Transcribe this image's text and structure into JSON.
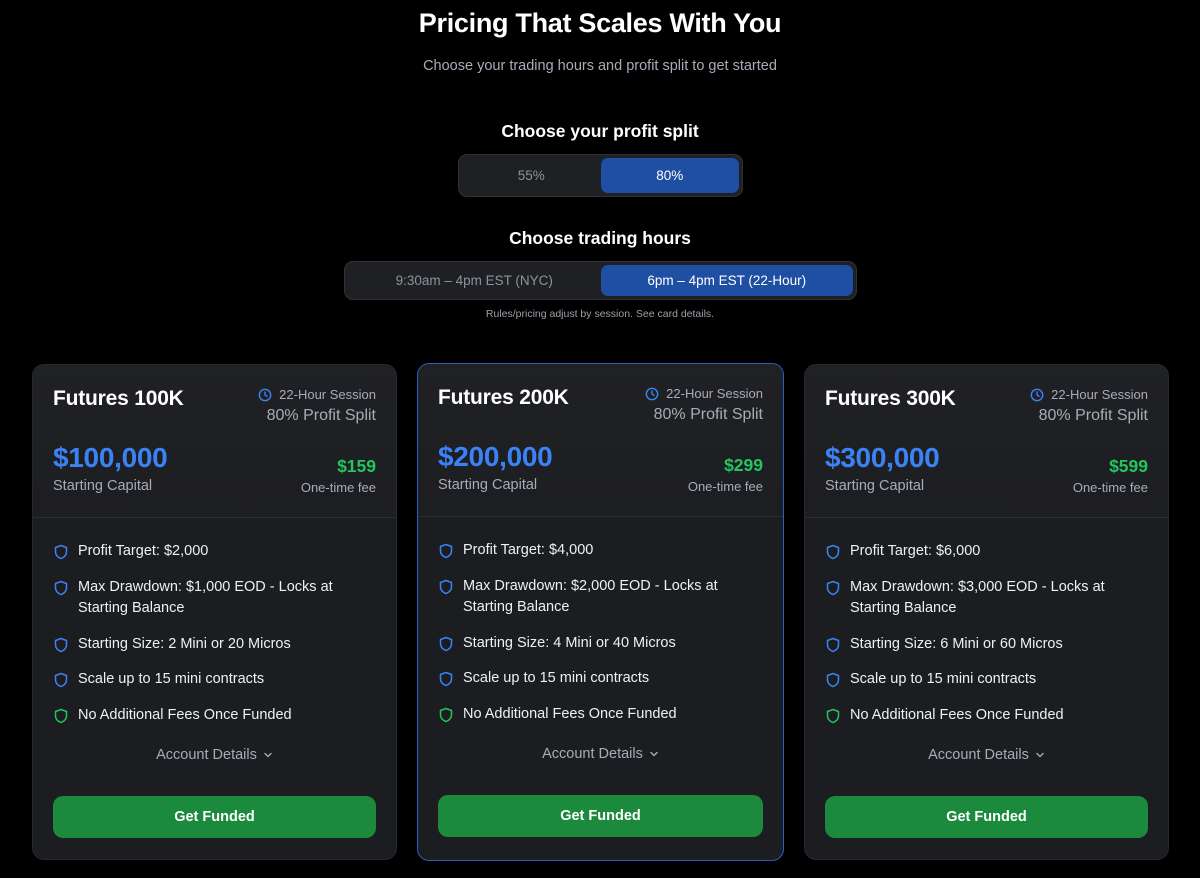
{
  "hero": {
    "title": "Pricing That Scales With You",
    "subtitle": "Choose your trading hours and profit split to get started"
  },
  "profit_split": {
    "label": "Choose your profit split",
    "options": [
      "55%",
      "80%"
    ],
    "selected": "80%"
  },
  "trading_hours": {
    "label": "Choose trading hours",
    "options": [
      "9:30am – 4pm EST (NYC)",
      "6pm – 4pm EST (22-Hour)"
    ],
    "selected": "6pm – 4pm EST (22-Hour)",
    "note": "Rules/pricing adjust by session. See card details."
  },
  "colors": {
    "accent_blue": "#3b82f6",
    "selected_blue": "#1f4fa3",
    "fee_green": "#22c55e",
    "cta_green": "#1b8a3c"
  },
  "cards": [
    {
      "name": "Futures 100K",
      "session": "22-Hour Session",
      "split": "80% Profit Split",
      "capital": "$100,000",
      "capital_label": "Starting Capital",
      "fee": "$159",
      "fee_label": "One-time fee",
      "features": [
        "Profit Target: $2,000",
        "Max Drawdown: $1,000 EOD - Locks at Starting Balance",
        "Starting Size: 2 Mini or 20 Micros",
        "Scale up to 15 mini contracts",
        "No Additional Fees Once Funded"
      ],
      "details": "Account Details",
      "cta": "Get Funded"
    },
    {
      "name": "Futures 200K",
      "session": "22-Hour Session",
      "split": "80% Profit Split",
      "capital": "$200,000",
      "capital_label": "Starting Capital",
      "fee": "$299",
      "fee_label": "One-time fee",
      "features": [
        "Profit Target: $4,000",
        "Max Drawdown: $2,000 EOD - Locks at Starting Balance",
        "Starting Size: 4 Mini or 40 Micros",
        "Scale up to 15 mini contracts",
        "No Additional Fees Once Funded"
      ],
      "details": "Account Details",
      "cta": "Get Funded"
    },
    {
      "name": "Futures 300K",
      "session": "22-Hour Session",
      "split": "80% Profit Split",
      "capital": "$300,000",
      "capital_label": "Starting Capital",
      "fee": "$599",
      "fee_label": "One-time fee",
      "features": [
        "Profit Target: $6,000",
        "Max Drawdown: $3,000 EOD - Locks at Starting Balance",
        "Starting Size: 6 Mini or 60 Micros",
        "Scale up to 15 mini contracts",
        "No Additional Fees Once Funded"
      ],
      "details": "Account Details",
      "cta": "Get Funded"
    }
  ]
}
